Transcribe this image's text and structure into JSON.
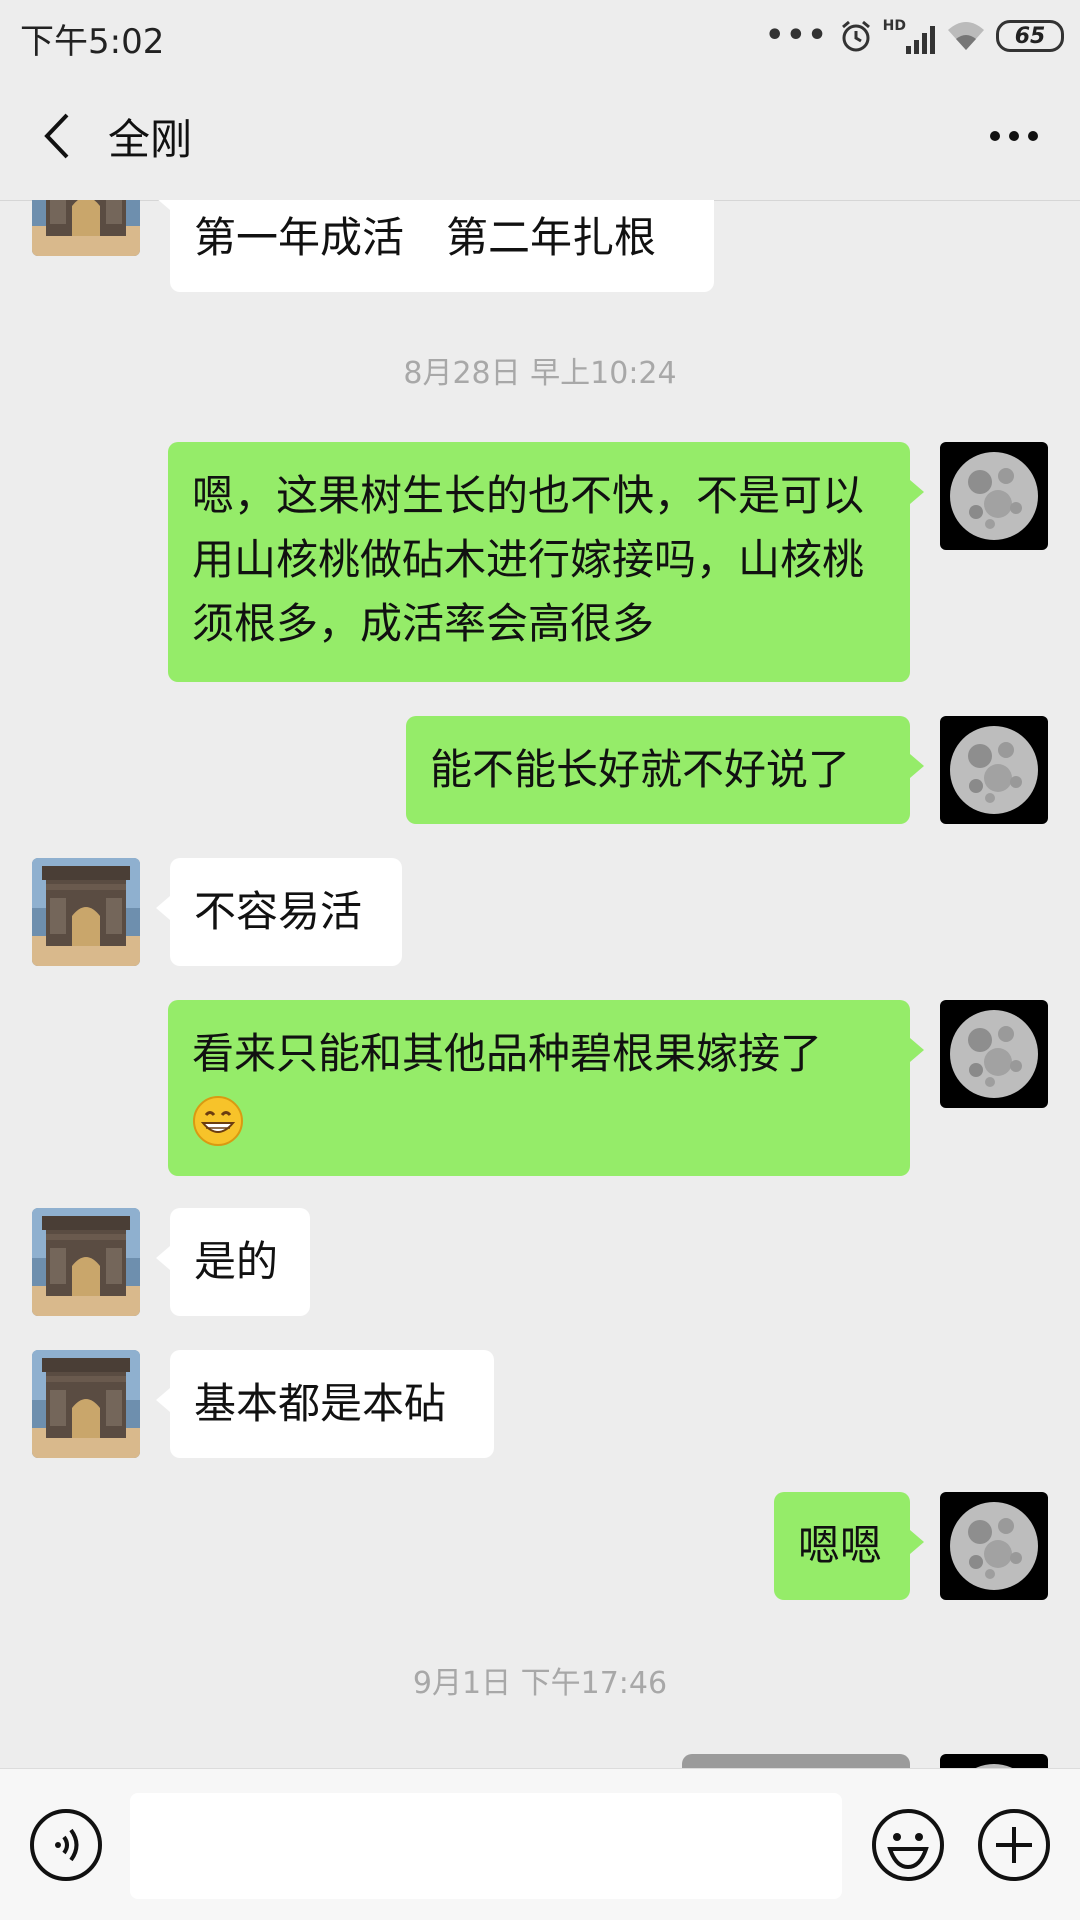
{
  "status_bar": {
    "time": "下午5:02",
    "battery": "65",
    "network_label": "HD"
  },
  "header": {
    "title": "全刚"
  },
  "messages": [
    {
      "type": "in",
      "text": "第一年成活　第二年扎根"
    },
    {
      "type": "timestamp",
      "text": "8月28日 早上10:24"
    },
    {
      "type": "out",
      "text": "嗯，这果树生长的也不快，不是可以用山核桃做砧木进行嫁接吗，山核桃须根多，成活率会高很多"
    },
    {
      "type": "out",
      "text": "能不能长好就不好说了"
    },
    {
      "type": "in",
      "text": "不容易活"
    },
    {
      "type": "out",
      "text": "看来只能和其他品种碧根果嫁接了",
      "emoji": "grin-emoji"
    },
    {
      "type": "in",
      "text": "是的"
    },
    {
      "type": "in",
      "text": "基本都是本砧"
    },
    {
      "type": "out",
      "text": "嗯嗯"
    },
    {
      "type": "timestamp",
      "text": "9月1日 下午17:46"
    }
  ],
  "input_bar": {
    "value": "",
    "icons": [
      "voice-icon",
      "emoji-icon",
      "plus-icon"
    ]
  },
  "colors": {
    "background": "#ededed",
    "outgoing_bubble": "#95ec69",
    "incoming_bubble": "#ffffff",
    "timestamp_text": "#a8a8a8"
  }
}
